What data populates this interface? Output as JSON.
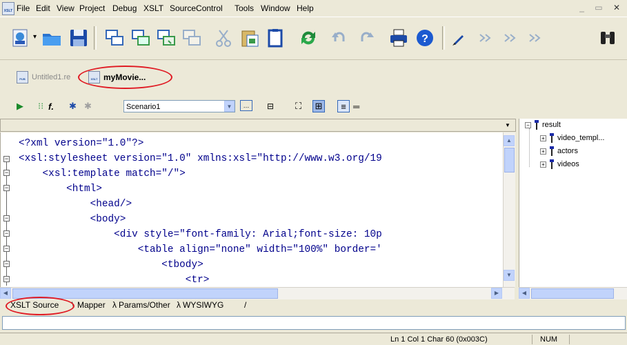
{
  "menubar": {
    "items": [
      "File",
      "Edit",
      "View",
      "Project",
      "Debug",
      "XSLT",
      "SourceControl",
      "Tools",
      "Window",
      "Help"
    ],
    "app_icon_text": "XSLT",
    "window_controls": "_ ▭ ✕"
  },
  "toolbar1": {
    "buttons": [
      "new-pub-file",
      "open-folder",
      "save",
      "window-1",
      "window-2",
      "window-3",
      "window-4",
      "cut",
      "paste",
      "copy",
      "refresh",
      "undo",
      "redo",
      "print",
      "help",
      "format",
      "indent-1",
      "indent-2",
      "indent-3",
      "find"
    ]
  },
  "doc_tabs": {
    "tab1_label": "Untitled1.re",
    "tab1_icon_text": "PUB",
    "tab2_label": "myMovie...",
    "tab2_icon_text": "XSLT"
  },
  "toolbar2": {
    "scenario_value": "Scenario1"
  },
  "editor": {
    "lines": [
      "<?xml version=\"1.0\"?>",
      "<xsl:stylesheet version=\"1.0\" xmlns:xsl=\"http://www.w3.org/19",
      "    <xsl:template match=\"/\">",
      "        <html>",
      "            <head/>",
      "            <body>",
      "                <div style=\"font-family: Arial;font-size: 10p",
      "                    <table align=\"none\" width=\"100%\" border='",
      "                        <tbody>",
      "                            <tr>"
    ]
  },
  "tree": {
    "root": "result",
    "children": [
      "video_templ...",
      "actors",
      "videos"
    ]
  },
  "bottom_tabs": [
    "XSLT Source",
    "Mapper",
    "Params/Other",
    "WYSIWYG"
  ],
  "status": {
    "position": "Ln 1 Col 1  Char 60 (0x003C)",
    "mode": "NUM"
  },
  "colors": {
    "highlight_circle": "#e01b24",
    "code_text": "#00008b",
    "chrome": "#ece9d8"
  }
}
